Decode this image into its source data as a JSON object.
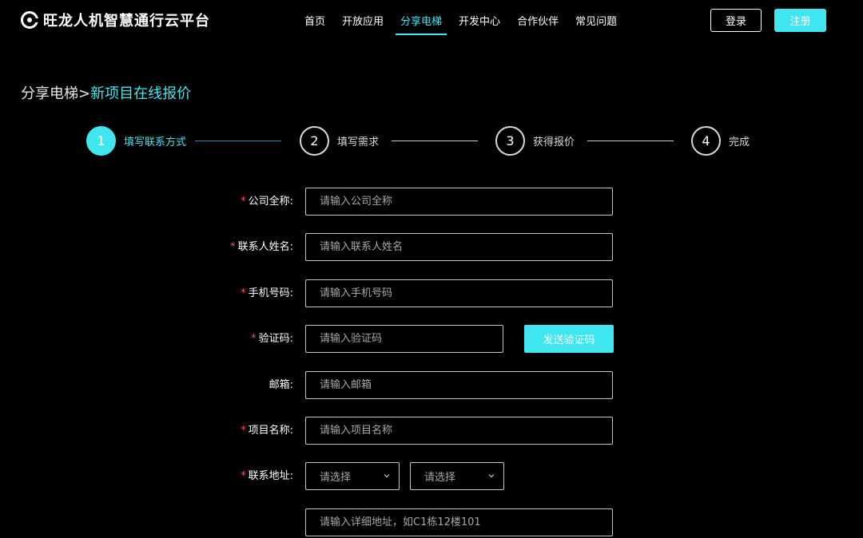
{
  "header": {
    "logo_text": "旺龙人机智慧通行云平台",
    "nav": [
      {
        "label": "首页"
      },
      {
        "label": "开放应用"
      },
      {
        "label": "分享电梯"
      },
      {
        "label": "开发中心"
      },
      {
        "label": "合作伙伴"
      },
      {
        "label": "常见问题"
      }
    ],
    "active_nav": "分享电梯",
    "login_label": "登录",
    "register_label": "注册"
  },
  "breadcrumb": {
    "parent": "分享电梯",
    "separator": ">",
    "current": "新项目在线报价"
  },
  "steps": [
    {
      "number": "1",
      "label": "填写联系方式",
      "active": true
    },
    {
      "number": "2",
      "label": "填写需求",
      "active": false
    },
    {
      "number": "3",
      "label": "获得报价",
      "active": false
    },
    {
      "number": "4",
      "label": "完成",
      "active": false
    }
  ],
  "form": {
    "required_mark": "*",
    "company": {
      "label": "公司全称:",
      "placeholder": "请输入公司全称"
    },
    "contact_name": {
      "label": "联系人姓名:",
      "placeholder": "请输入联系人姓名"
    },
    "phone": {
      "label": "手机号码:",
      "placeholder": "请输入手机号码"
    },
    "code": {
      "label": "验证码:",
      "placeholder": "请输入验证码",
      "button_label": "发送验证码"
    },
    "email": {
      "label": "邮箱:",
      "placeholder": "请输入邮箱"
    },
    "project_name": {
      "label": "项目名称:",
      "placeholder": "请输入项目名称"
    },
    "address": {
      "label": "联系地址:",
      "select1": "请选择",
      "select2": "请选择",
      "detail_placeholder": "请输入详细地址，如C1栋12楼101"
    }
  },
  "colors": {
    "accent": "#3fe6f0",
    "background": "#000000",
    "required": "#ff4d4f"
  }
}
